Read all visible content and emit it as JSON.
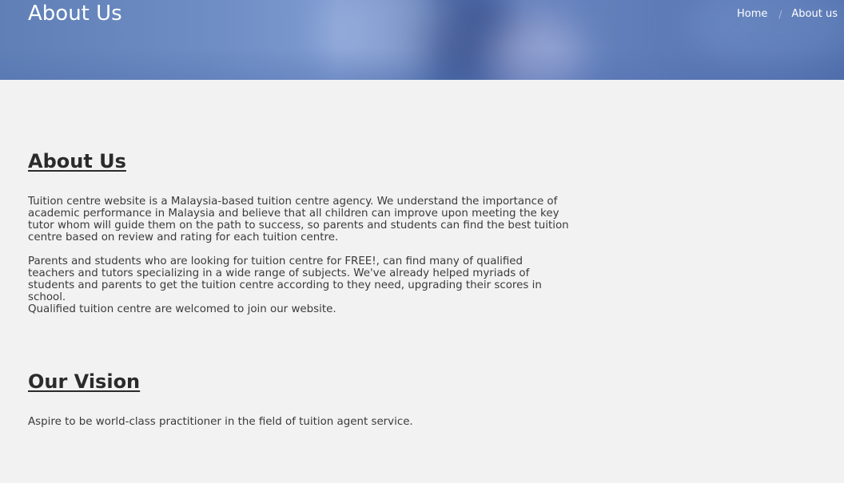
{
  "header": {
    "title": "About Us",
    "breadcrumb": {
      "home": "Home",
      "current": "About us"
    }
  },
  "about": {
    "heading": "About Us",
    "paragraphs": [
      "Tuition centre website is a Malaysia-based tuition centre agency. We understand the importance of academic performance in Malaysia and believe that all children can improve upon meeting the key tutor whom will guide them on the path to success, so parents and students can find the best tuition centre based on review and rating for each tuition centre.",
      "Parents and students who are looking for tuition centre for FREE!, can find many of qualified teachers and tutors specializing in a wide range of subjects. We've already helped myriads of students and parents to get the tuition centre according to they need, upgrading their scores in school.",
      "Qualified tuition centre are welcomed to join our website."
    ]
  },
  "vision": {
    "heading": "Our Vision",
    "text": "Aspire to be world-class practitioner in the field of tuition agent service."
  }
}
